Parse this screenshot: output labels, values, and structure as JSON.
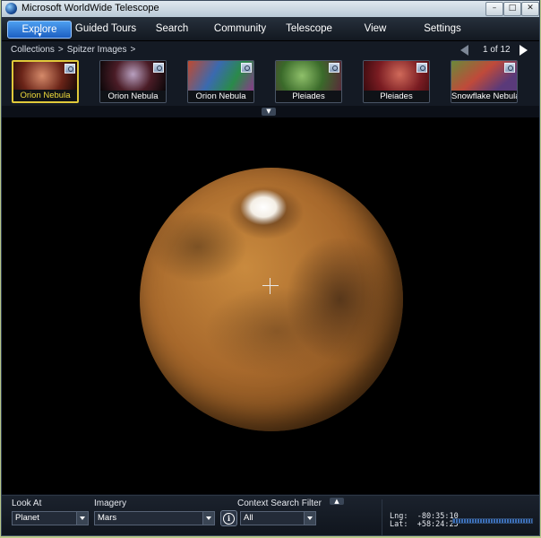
{
  "window": {
    "title": "Microsoft WorldWide Telescope",
    "icon": "wwt-globe-icon",
    "controls": {
      "minimize": "–",
      "maximize": "□",
      "close": "✕"
    }
  },
  "menu": {
    "tabs": [
      {
        "label": "Explore",
        "active": true
      },
      {
        "label": "Guided Tours"
      },
      {
        "label": "Search"
      },
      {
        "label": "Community"
      },
      {
        "label": "Telescope"
      },
      {
        "label": "View"
      },
      {
        "label": "Settings"
      }
    ]
  },
  "breadcrumb": {
    "items": [
      "Collections",
      ">",
      "Spitzer Images",
      ">"
    ]
  },
  "pager": {
    "text": "1 of 12"
  },
  "thumbnails": [
    {
      "label": "Orion Nebula",
      "selected": true,
      "color": "#5a1f18"
    },
    {
      "label": "Orion Nebula",
      "color": "#3a1a1e"
    },
    {
      "label": "Orion Nebula",
      "color": "#4b3a5a"
    },
    {
      "label": "Pleiades",
      "color": "#3f6a2c"
    },
    {
      "label": "Pleiades",
      "color": "#7a1c22"
    },
    {
      "label": "Snowflake Nebula",
      "color": "#4f5a2a"
    }
  ],
  "viewport": {
    "object": "Mars"
  },
  "bottom": {
    "look_at": {
      "label": "Look At",
      "value": "Planet"
    },
    "imagery": {
      "label": "Imagery",
      "value": "Mars"
    },
    "context": {
      "label": "Context Search Filter",
      "value": "All"
    },
    "coords": {
      "lng": "Lng:  -80:35:10",
      "lat": "Lat:  +58:24:25"
    }
  },
  "colors": {
    "accent": "#2f7fe0",
    "selected_thumb": "#e0c93a"
  }
}
